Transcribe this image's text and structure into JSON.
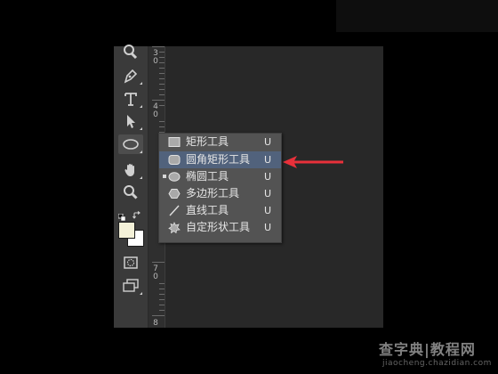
{
  "ruler": {
    "labels": [
      "3",
      "0",
      "4",
      "0",
      "7",
      "0",
      "8"
    ]
  },
  "toolbar": {
    "tools": [
      "zoom-partial",
      "pen",
      "type",
      "path-selection",
      "rounded-rectangle",
      "hand",
      "zoom",
      "default-colors",
      "swap-colors",
      "color-swatches",
      "quick-mask",
      "screen-mode"
    ]
  },
  "flyout": {
    "items": [
      {
        "label": "矩形工具",
        "shortcut": "U",
        "icon": "rectangle-icon",
        "selected": false,
        "highlighted": false
      },
      {
        "label": "圆角矩形工具",
        "shortcut": "U",
        "icon": "rounded-rectangle-icon",
        "selected": false,
        "highlighted": true
      },
      {
        "label": "椭圆工具",
        "shortcut": "U",
        "icon": "ellipse-icon",
        "selected": true,
        "highlighted": false
      },
      {
        "label": "多边形工具",
        "shortcut": "U",
        "icon": "polygon-icon",
        "selected": false,
        "highlighted": false
      },
      {
        "label": "直线工具",
        "shortcut": "U",
        "icon": "line-icon",
        "selected": false,
        "highlighted": false
      },
      {
        "label": "自定形状工具",
        "shortcut": "U",
        "icon": "custom-shape-icon",
        "selected": false,
        "highlighted": false
      }
    ]
  },
  "annotation": {
    "arrow_color": "#e8303a"
  },
  "watermark": {
    "top": "查字典|教程网",
    "bottom": "jiaocheng.chazidian.com"
  },
  "colors": {
    "background": "#000000",
    "workspace": "#282828",
    "toolbar": "#3a3a3a",
    "flyout": "#535353",
    "highlight": "#51627c",
    "foreground_swatch": "#f4f1d8",
    "background_swatch": "#ffffff"
  }
}
